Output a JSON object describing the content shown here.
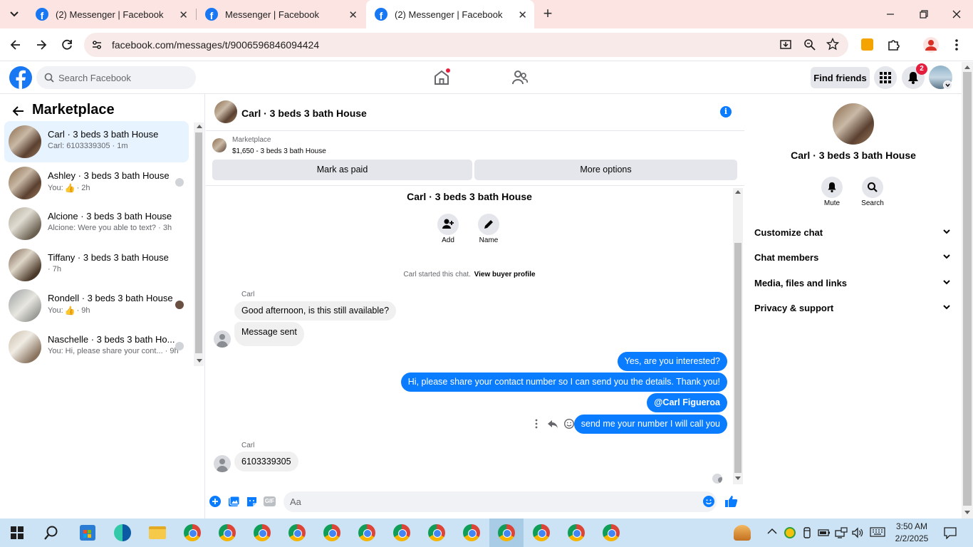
{
  "browser": {
    "tabs": [
      {
        "label": "(2) Messenger | Facebook"
      },
      {
        "label": "Messenger | Facebook"
      },
      {
        "label": "(2) Messenger | Facebook"
      }
    ],
    "url": "facebook.com/messages/t/9006596846094424"
  },
  "fb": {
    "search_placeholder": "Search Facebook",
    "find_friends": "Find friends",
    "notif_count": "2"
  },
  "sidebar": {
    "title": "Marketplace",
    "conversations": [
      {
        "name": "Carl · 3 beds 3 bath House",
        "sub": "Carl: 6103339305 · 1m"
      },
      {
        "name": "Ashley · 3 beds 3 bath House",
        "sub": "You:",
        "time": "· 2h"
      },
      {
        "name": "Alcione · 3 beds 3 bath House",
        "sub": "Alcione: Were you able to text? · 3h"
      },
      {
        "name": "Tiffany · 3 beds 3 bath House",
        "sub": "· 7h"
      },
      {
        "name": "Rondell · 3 beds 3 bath House",
        "sub": "You:",
        "time": "· 9h"
      },
      {
        "name": "Naschelle · 3 beds 3 bath Ho...",
        "sub": "You: Hi, please share your cont...",
        "time": "· 9h"
      }
    ]
  },
  "chat": {
    "header_title": "Carl · 3 beds 3 bath House",
    "listing_source": "Marketplace",
    "listing_price": "$1,650 - 3 beds 3 bath House",
    "mark_paid": "Mark as paid",
    "more_options": "More options",
    "intro_title": "Carl · 3 beds 3 bath House",
    "add_label": "Add",
    "name_label": "Name",
    "started_text": "Carl started this chat.",
    "view_profile": "View buyer profile",
    "messages": [
      {
        "sender": "Carl",
        "text": "Good afternoon, is this still available?"
      },
      {
        "text": "Message sent"
      },
      {
        "text": "Yes, are you interested?"
      },
      {
        "text": "Hi, please share your contact number so I can send you the details. Thank you!"
      },
      {
        "text": "@Carl Figueroa"
      },
      {
        "text": "send me your number I will call you"
      },
      {
        "sender": "Carl",
        "text": "6103339305"
      }
    ],
    "composer_placeholder": "Aa"
  },
  "details": {
    "title": "Carl · 3 beds 3 bath House",
    "mute": "Mute",
    "search": "Search",
    "sections": [
      "Customize chat",
      "Chat members",
      "Media, files and links",
      "Privacy & support"
    ]
  },
  "taskbar": {
    "time": "3:50 AM",
    "date": "2/2/2025"
  },
  "colors": {
    "brand": "#1877f2",
    "bubble_blue": "#0a7cff",
    "tab_bg": "#fbe4e1",
    "taskbar_bg": "#cbe3f4"
  }
}
